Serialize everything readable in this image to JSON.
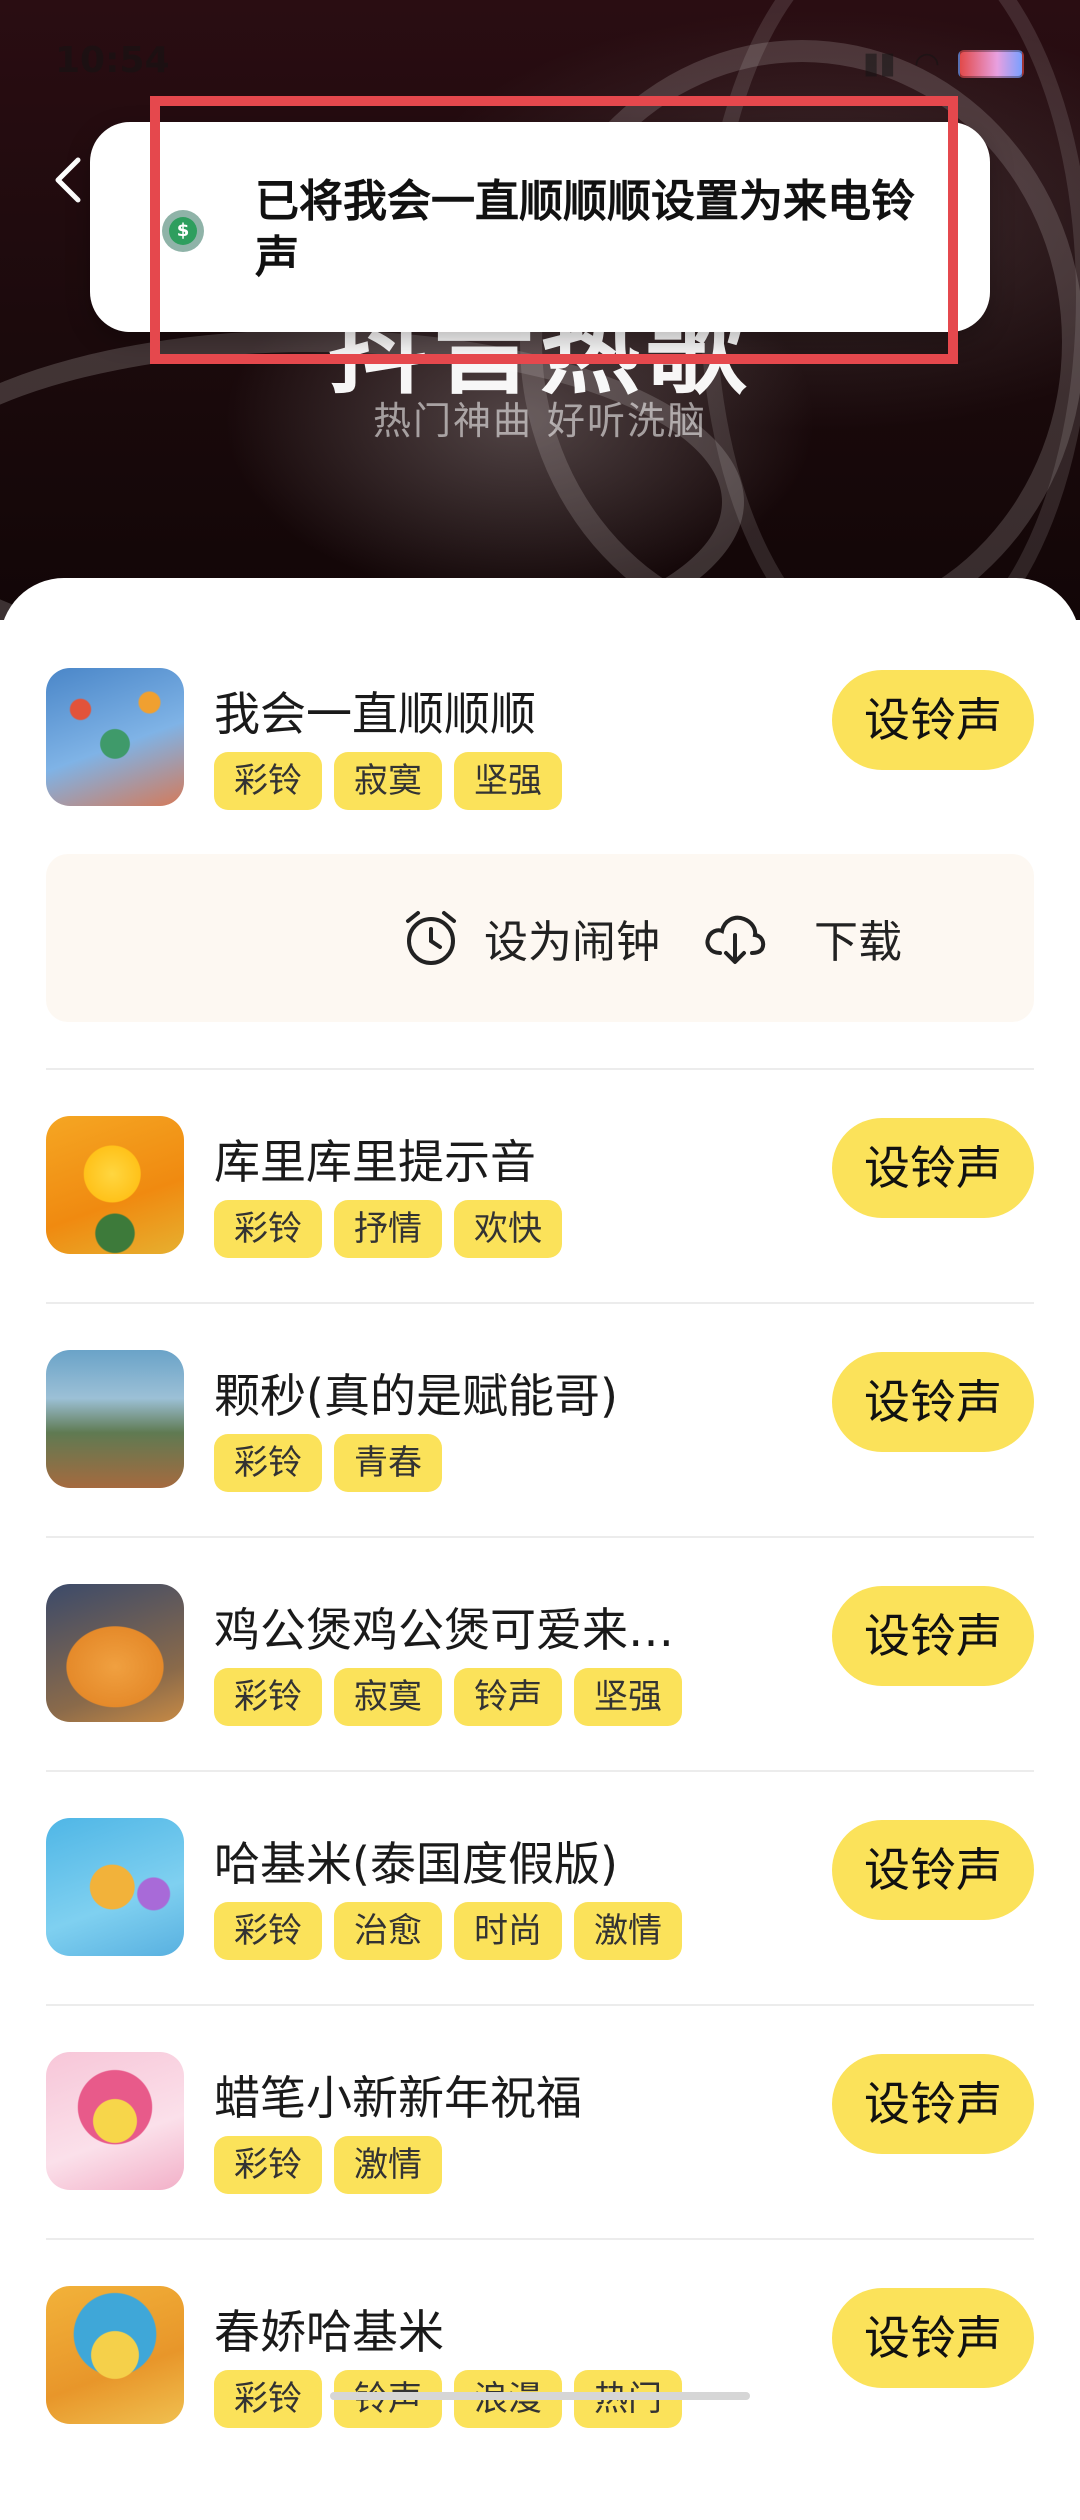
{
  "status_bar": {
    "time": "10:54"
  },
  "header": {
    "title": "抖音热歌",
    "subtitle": "热门神曲 好听洗脑"
  },
  "toast": {
    "message": "已将我会一直顺顺顺设置为来电铃声"
  },
  "actions": {
    "alarm_label": "设为闹钟",
    "download_label": "下载"
  },
  "songs": [
    {
      "title": "我会一直顺顺顺",
      "tags": [
        "彩铃",
        "寂寞",
        "坚强"
      ],
      "button": "设铃声"
    },
    {
      "title": "库里库里提示音",
      "tags": [
        "彩铃",
        "抒情",
        "欢快"
      ],
      "button": "设铃声"
    },
    {
      "title": "颗秒(真的是赋能哥)",
      "tags": [
        "彩铃",
        "青春"
      ],
      "button": "设铃声"
    },
    {
      "title": "鸡公煲鸡公煲可爱来…",
      "tags": [
        "彩铃",
        "寂寞",
        "铃声",
        "坚强"
      ],
      "button": "设铃声"
    },
    {
      "title": "哈基米(泰国度假版)",
      "tags": [
        "彩铃",
        "治愈",
        "时尚",
        "激情"
      ],
      "button": "设铃声"
    },
    {
      "title": "蜡笔小新新年祝福",
      "tags": [
        "彩铃",
        "激情"
      ],
      "button": "设铃声"
    },
    {
      "title": "春娇哈基米",
      "tags": [
        "彩铃",
        "铃声",
        "浪漫",
        "热门"
      ],
      "button": "设铃声"
    }
  ],
  "colors": {
    "accent": "#fbe25a",
    "highlight": "#e5484d",
    "hero_bg": "#1b0a0c"
  },
  "icons": [
    "back-arrow-icon",
    "ringtone-app-icon",
    "alarm-clock-icon",
    "download-cloud-icon"
  ]
}
